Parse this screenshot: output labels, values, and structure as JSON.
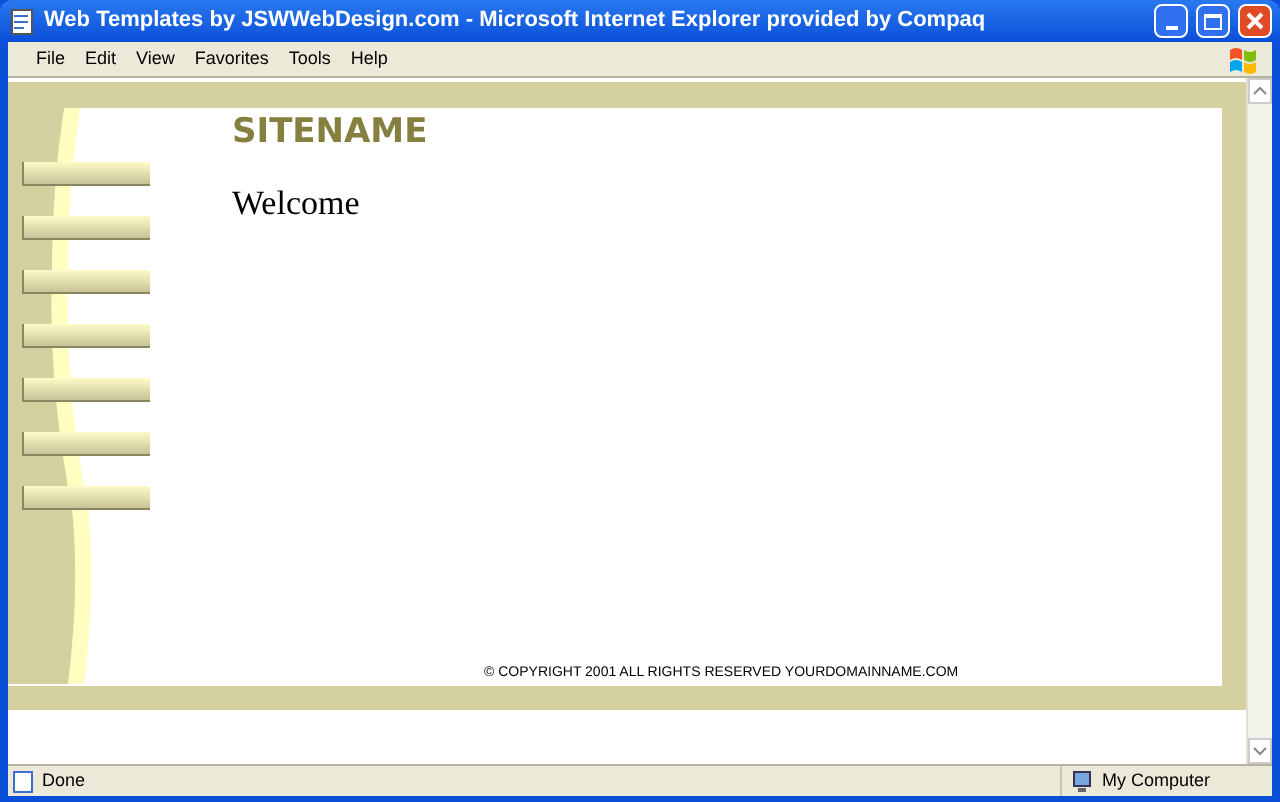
{
  "window": {
    "title": "Web Templates by JSWWebDesign.com - Microsoft Internet Explorer provided by Compaq"
  },
  "menu": [
    "File",
    "Edit",
    "View",
    "Favorites",
    "Tools",
    "Help"
  ],
  "page": {
    "sitename": "SITENAME",
    "heading": "Welcome",
    "nav_buttons": [
      {
        "kind": "button"
      },
      {
        "kind": "button"
      },
      {
        "kind": "button"
      },
      {
        "kind": "button"
      },
      {
        "kind": "button"
      },
      {
        "kind": "button"
      },
      {
        "kind": "button"
      }
    ],
    "copyright": "© COPYRIGHT 2001 ALL RIGHTS RESERVED YOURDOMAINNAME.COM"
  },
  "status_bar": {
    "status": "Done",
    "zone": "My Computer"
  }
}
